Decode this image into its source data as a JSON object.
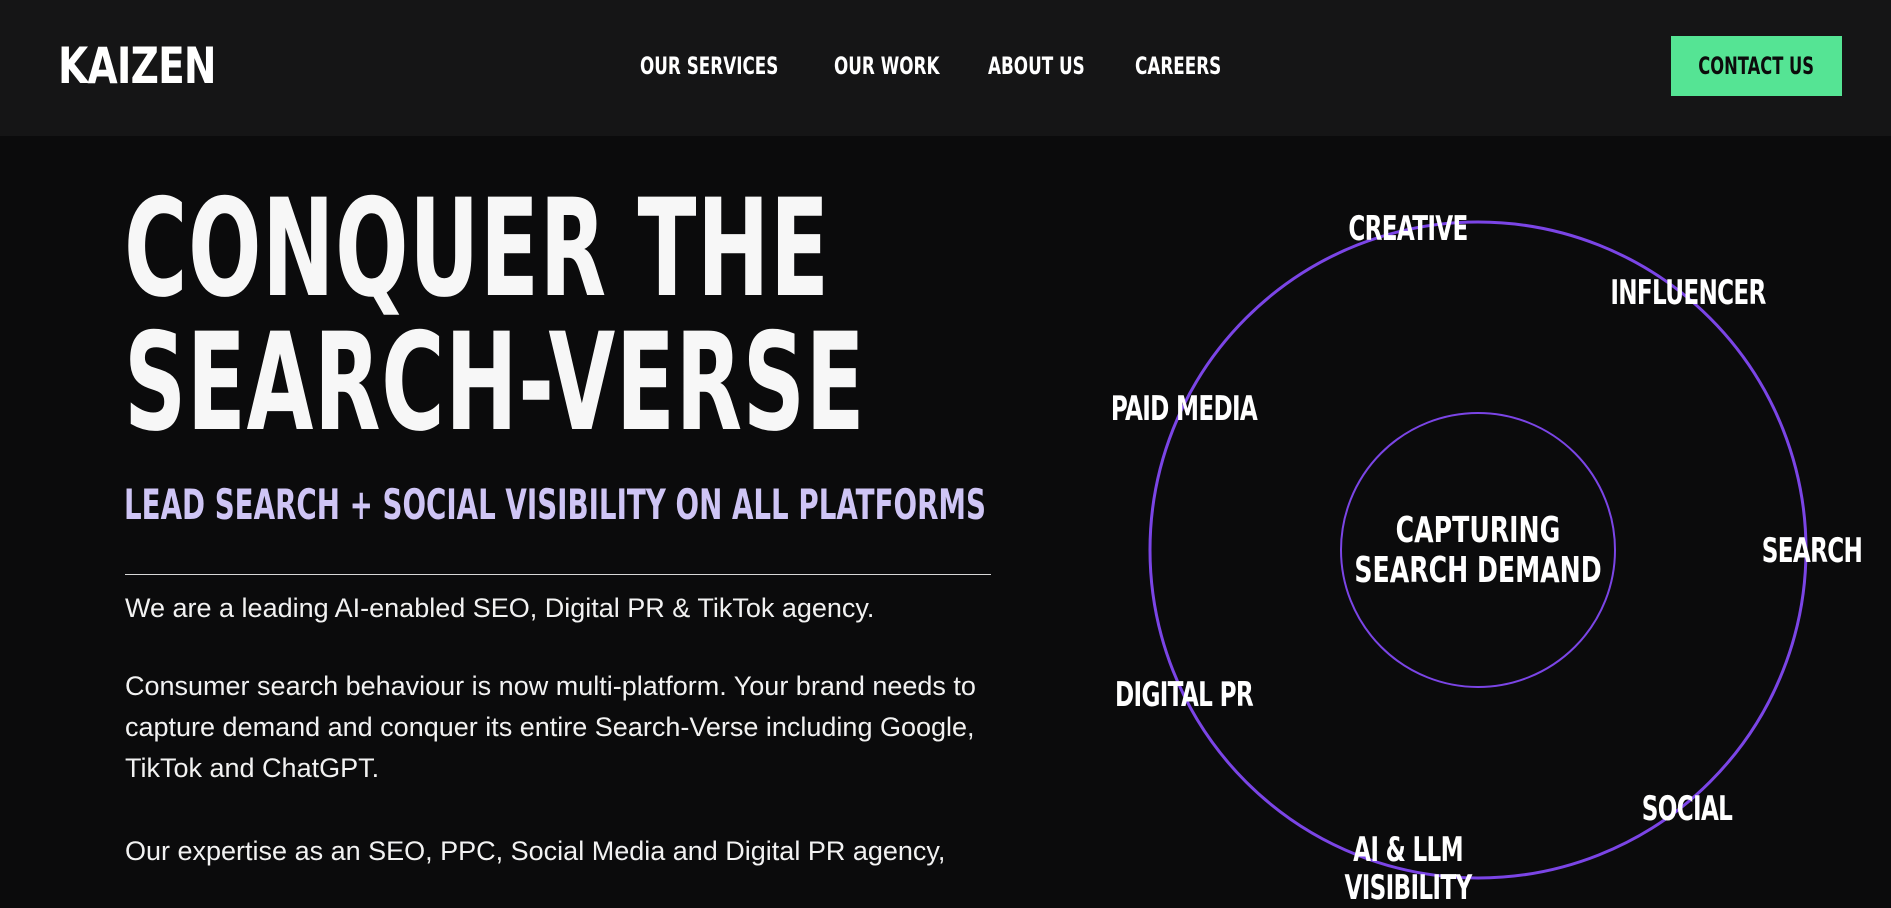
{
  "header": {
    "logo": "KAIZEN",
    "nav": [
      {
        "label": "OUR SERVICES"
      },
      {
        "label": "OUR WORK"
      },
      {
        "label": "ABOUT US"
      },
      {
        "label": "CAREERS"
      }
    ],
    "cta_label": "CONTACT US"
  },
  "hero": {
    "title_line1": "CONQUER THE",
    "title_line2": "SEARCH-VERSE",
    "subtitle": "LEAD SEARCH + SOCIAL VISIBILITY ON ALL PLATFORMS",
    "paragraph1": "We are a leading AI-enabled SEO, Digital PR & TikTok agency.",
    "paragraph2": "Consumer search behaviour is now multi-platform. Your brand needs to capture demand and conquer its entire Search-Verse including Google, TikTok and ChatGPT.",
    "paragraph3": "Our expertise as an SEO, PPC, Social Media and Digital PR agency,"
  },
  "diagram": {
    "center_line1": "CAPTURING",
    "center_line2": "SEARCH DEMAND",
    "labels": {
      "creative": "CREATIVE",
      "influencer": "INFLUENCER",
      "paid_media": "PAID MEDIA",
      "search": "SEARCH",
      "digital_pr": "DIGITAL PR",
      "social": "SOCIAL",
      "ai_llm": "AI & LLM",
      "ai_llm_line2": "VISIBILITY"
    }
  },
  "colors": {
    "accent_green": "#55e494",
    "orbit_purple": "#7b45e6",
    "subtitle_lavender": "#cfc5f5",
    "background": "#0b0b0c",
    "header_background": "#151516"
  }
}
